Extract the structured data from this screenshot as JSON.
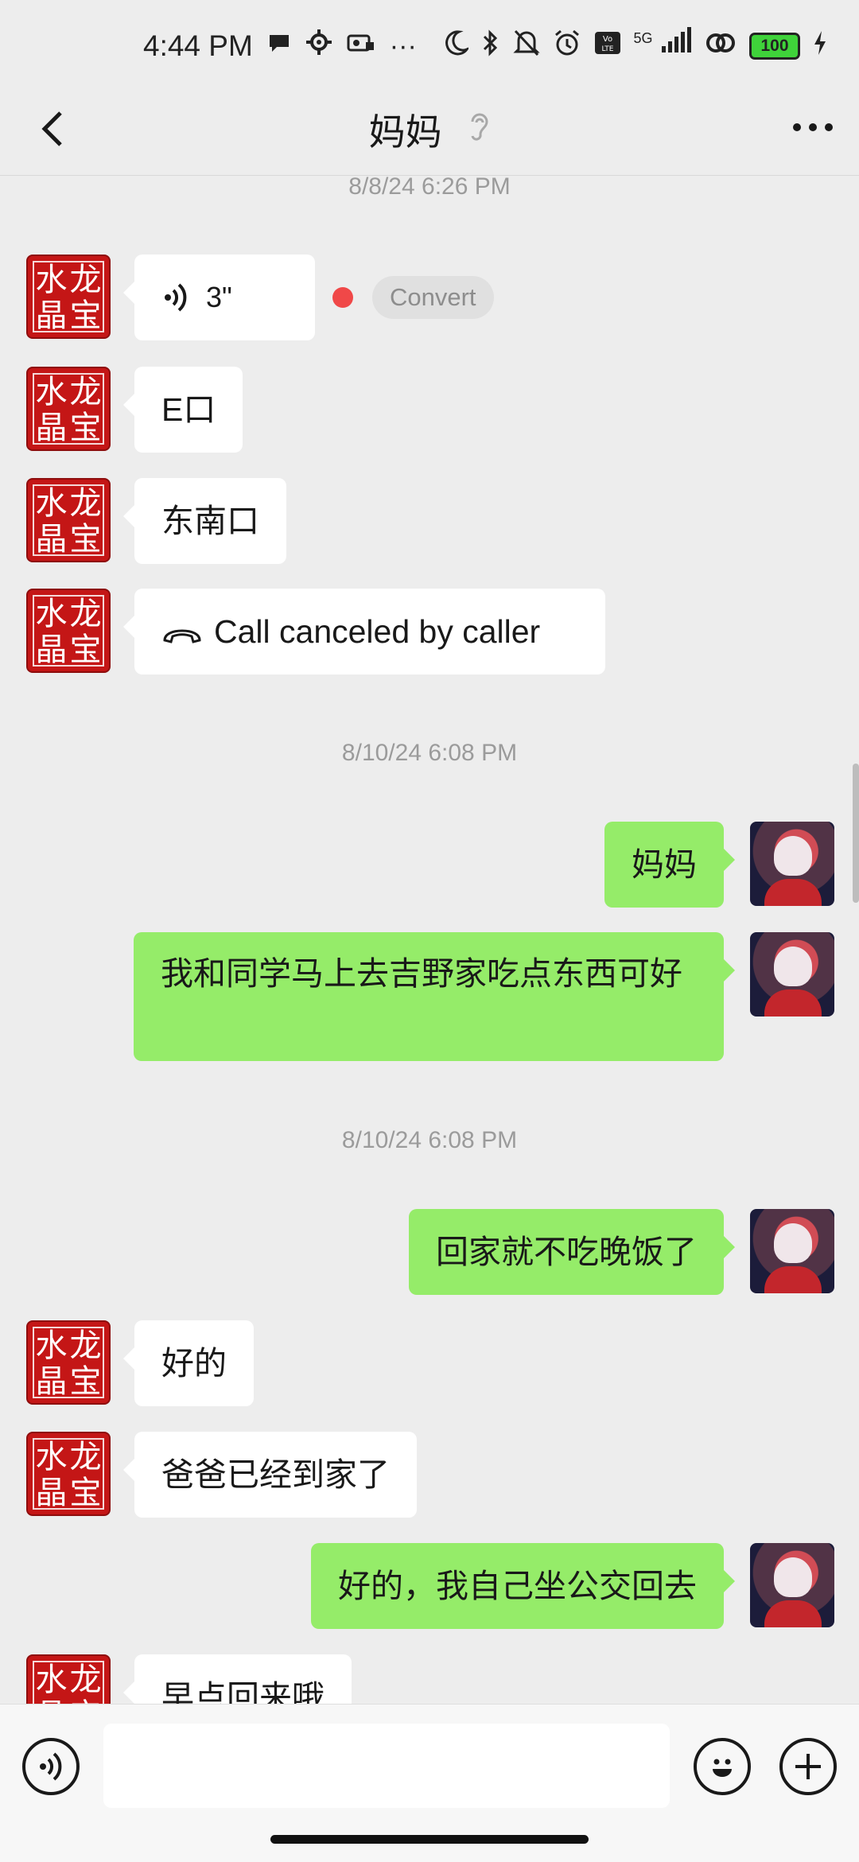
{
  "status_bar": {
    "time": "4:44 PM",
    "network": "5G",
    "battery": "100",
    "icons": [
      "chat-bubble-icon",
      "settings-gear-icon",
      "vpn-card-icon",
      "more-dots-icon",
      "moon-icon",
      "bluetooth-icon",
      "mute-bell-icon",
      "alarm-icon",
      "volte-icon",
      "signal-icon",
      "link-icon",
      "battery-icon",
      "charging-icon"
    ],
    "more_label": "···"
  },
  "header": {
    "title": "妈妈",
    "listening_icon": "ear-icon"
  },
  "messages": [
    {
      "type": "timestamp",
      "text": "8/8/24 6:26 PM"
    },
    {
      "type": "voice",
      "from": "them",
      "duration": "3\"",
      "convert_label": "Convert"
    },
    {
      "type": "text",
      "from": "them",
      "text": "E口"
    },
    {
      "type": "text",
      "from": "them",
      "text": "东南口"
    },
    {
      "type": "call",
      "from": "them",
      "text": "Call canceled by caller"
    },
    {
      "type": "timestamp",
      "text": "8/10/24 6:08 PM"
    },
    {
      "type": "text",
      "from": "me",
      "text": "妈妈"
    },
    {
      "type": "text",
      "from": "me",
      "text": "我和同学马上去吉野家吃点东西可好"
    },
    {
      "type": "timestamp",
      "text": "8/10/24 6:08 PM"
    },
    {
      "type": "text",
      "from": "me",
      "text": "回家就不吃晚饭了"
    },
    {
      "type": "text",
      "from": "them",
      "text": "好的"
    },
    {
      "type": "text",
      "from": "them",
      "text": "爸爸已经到家了"
    },
    {
      "type": "text",
      "from": "me",
      "text": "好的，我自己坐公交回去"
    },
    {
      "type": "text",
      "from": "them",
      "text": "早点回来哦"
    }
  ],
  "contact_avatar_text": [
    "水",
    "龙",
    "晶",
    "宝"
  ],
  "colors": {
    "outgoing": "#95ec69",
    "incoming": "#ffffff",
    "background": "#ededed",
    "accent_red": "#f04848"
  }
}
